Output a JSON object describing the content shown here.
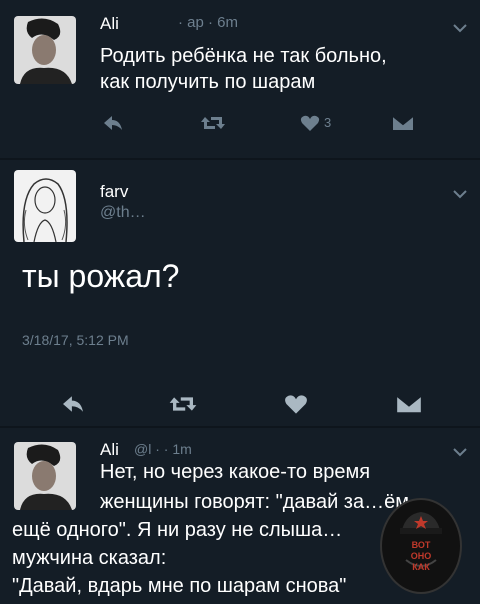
{
  "tweet1": {
    "name": "Ali",
    "meta": "· ар · 6m",
    "text_line1": "Родить ребёнка не так больно,",
    "text_line2": "как получить по шарам",
    "like_count": "3"
  },
  "tweet2": {
    "name": "farv",
    "handle": "@th…",
    "text": "ты рожал?",
    "timestamp": "3/18/17, 5:12 PM"
  },
  "tweet3": {
    "name": "Ali",
    "meta": "@l · · 1m",
    "lines": [
      "Нет, но через какое-то время",
      "женщины говорят: \"давай за…ём",
      "ещё одного\". Я ни разу не слыша…",
      "мужчина сказал:",
      "\"Давай, вдарь мне по шарам снова\""
    ]
  },
  "watermark": {
    "line1": "ВОТ",
    "line2": "ОНО",
    "line3": "КАК"
  },
  "colors": {
    "background": "#141d26",
    "muted": "#6d7f8e",
    "text": "#ffffff"
  },
  "icons": [
    "reply-icon",
    "retweet-icon",
    "like-icon",
    "dm-icon",
    "chevron-down-icon"
  ]
}
